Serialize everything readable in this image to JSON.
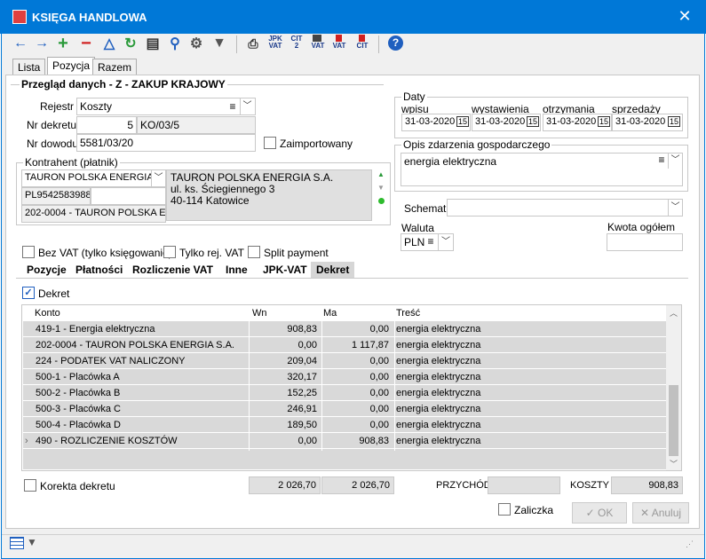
{
  "window": {
    "title": "KSIĘGA HANDLOWA",
    "close": "✕"
  },
  "toolbar": {
    "jpk_vat": "JPK\nVAT",
    "cit2": "CIT\n2",
    "vat_v": "VAT",
    "vat_r": "VAT",
    "cit_r": "CIT"
  },
  "tabs": [
    "Lista",
    "Pozycja",
    "Razem"
  ],
  "header": {
    "title": "Przegląd danych - Z - ZAKUP KRAJOWY"
  },
  "form": {
    "rejestr_label": "Rejestr",
    "rejestr_value": "Koszty",
    "nr_dekretu_label": "Nr dekretu",
    "nr_dekretu_num": "5",
    "nr_dekretu_code": "KO/03/5",
    "nr_dowodu_label": "Nr dowodu",
    "nr_dowodu_value": "5581/03/20",
    "zaimportowany_label": "Zaimportowany"
  },
  "kontrahent": {
    "label": "Kontrahent (płatnik)",
    "name": "TAURON POLSKA ENERGIA S.A.",
    "nip": "PL9542583988",
    "code": "202-0004 - TAURON POLSKA ENERGIA S.A.",
    "addr1": "TAURON POLSKA ENERGIA S.A.",
    "addr2": "ul. ks. Ściegiennego 3",
    "addr3": "40-114 Katowice"
  },
  "daty": {
    "label": "Daty",
    "wpisu_label": "wpisu",
    "wpisu": "31-03-2020",
    "wystawienia_label": "wystawienia",
    "wystawienia": "31-03-2020",
    "otrzymania_label": "otrzymania",
    "otrzymania": "31-03-2020",
    "sprzedazy_label": "sprzedaży",
    "sprzedazy": "31-03-2020"
  },
  "opis": {
    "label": "Opis zdarzenia gospodarczego",
    "value": "energia elektryczna"
  },
  "schemat_label": "Schemat",
  "waluta": {
    "label": "Waluta",
    "value": "PLN"
  },
  "kwota_label": "Kwota ogółem",
  "checks": {
    "bez_vat": "Bez VAT (tylko księgowanie)",
    "tylko_rej": "Tylko rej. VAT",
    "split": "Split payment"
  },
  "subtabs": [
    "Pozycje",
    "Płatności",
    "Rozliczenie VAT",
    "Inne",
    "JPK-VAT",
    "Dekret"
  ],
  "dekret_check": "Dekret",
  "grid": {
    "headers": [
      "Konto",
      "Wn",
      "Ma",
      "Treść"
    ],
    "rows": [
      {
        "konto": "419-1 - Energia elektryczna",
        "wn": "908,83",
        "ma": "0,00",
        "tresc": "energia elektryczna"
      },
      {
        "konto": "202-0004 - TAURON POLSKA ENERGIA S.A.",
        "wn": "0,00",
        "ma": "1 117,87",
        "tresc": "energia elektryczna"
      },
      {
        "konto": "224 - PODATEK VAT NALICZONY",
        "wn": "209,04",
        "ma": "0,00",
        "tresc": "energia elektryczna"
      },
      {
        "konto": "500-1 - Placówka A",
        "wn": "320,17",
        "ma": "0,00",
        "tresc": "energia elektryczna"
      },
      {
        "konto": "500-2 - Placówka B",
        "wn": "152,25",
        "ma": "0,00",
        "tresc": "energia elektryczna"
      },
      {
        "konto": "500-3 - Placówka C",
        "wn": "246,91",
        "ma": "0,00",
        "tresc": "energia elektryczna"
      },
      {
        "konto": "500-4 - Placówka D",
        "wn": "189,50",
        "ma": "0,00",
        "tresc": "energia elektryczna"
      },
      {
        "konto": "490 - ROZLICZENIE KOSZTÓW",
        "wn": "0,00",
        "ma": "908,83",
        "tresc": "energia elektryczna"
      }
    ]
  },
  "footer": {
    "korekta": "Korekta dekretu",
    "sum_wn": "2 026,70",
    "sum_ma": "2 026,70",
    "przychod_label": "PRZYCHÓD",
    "przychod": "",
    "koszty_label": "KOSZTY",
    "koszty": "908,83",
    "zaliczka": "Zaliczka",
    "ok": "OK",
    "anuluj": "Anuluj"
  }
}
